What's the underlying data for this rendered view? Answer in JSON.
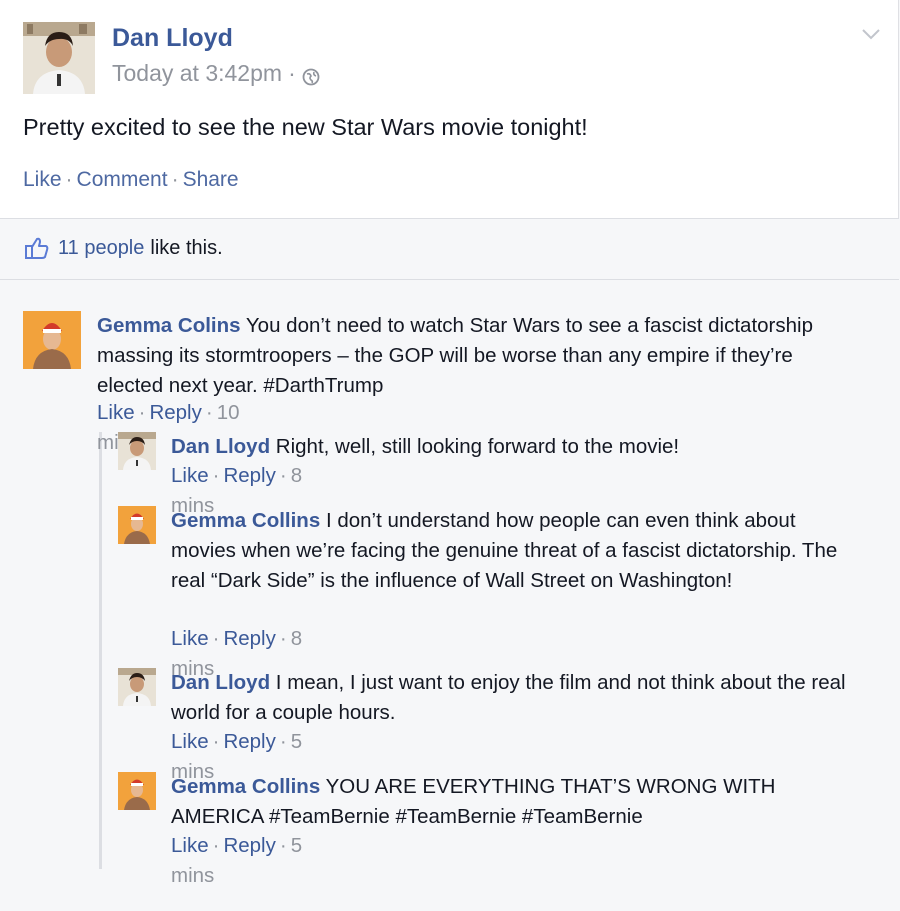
{
  "post": {
    "author": "Dan Lloyd",
    "timestamp": "Today at 3:42pm",
    "separator": "·",
    "text": "Pretty excited to see the new Star Wars movie tonight!",
    "actions": {
      "like": "Like",
      "comment": "Comment",
      "share": "Share"
    },
    "likes_count": "11 people",
    "likes_suffix": "like this."
  },
  "comments": [
    {
      "name": "Gemma Colins",
      "text": "You don’t need to watch Star Wars to see a fascist dictatorship massing its stormtroopers – the GOP will be worse than any empire if they’re elected next year. #DarthTrump",
      "like": "Like",
      "reply": "Reply",
      "time": "10 mins"
    },
    {
      "name": "Dan Lloyd",
      "text": "Right, well, still looking forward to the movie!",
      "like": "Like",
      "reply": "Reply",
      "time": "8 mins"
    },
    {
      "name": "Gemma Collins",
      "text": "I don’t understand how people can even think about movies when we’re facing the genuine threat of a fascist dictatorship. The real “Dark Side” is the influence of Wall Street on Washington!",
      "like": "Like",
      "reply": "Reply",
      "time": "8 mins"
    },
    {
      "name": "Dan Lloyd",
      "text": "I mean, I just want to enjoy the film and not think about the real world for a couple hours.",
      "like": "Like",
      "reply": "Reply",
      "time": "5 mins"
    },
    {
      "name": "Gemma Collins",
      "text": "YOU ARE EVERYTHING THAT’S WRONG WITH AMERICA #TeamBernie #TeamBernie #TeamBernie",
      "like": "Like",
      "reply": "Reply",
      "time": "5 mins"
    }
  ],
  "colors": {
    "link": "#3b5998",
    "meta": "#90949c",
    "background": "#f6f7f9"
  },
  "icons": [
    "globe-icon",
    "chevron-down-icon",
    "thumbs-up-icon"
  ]
}
